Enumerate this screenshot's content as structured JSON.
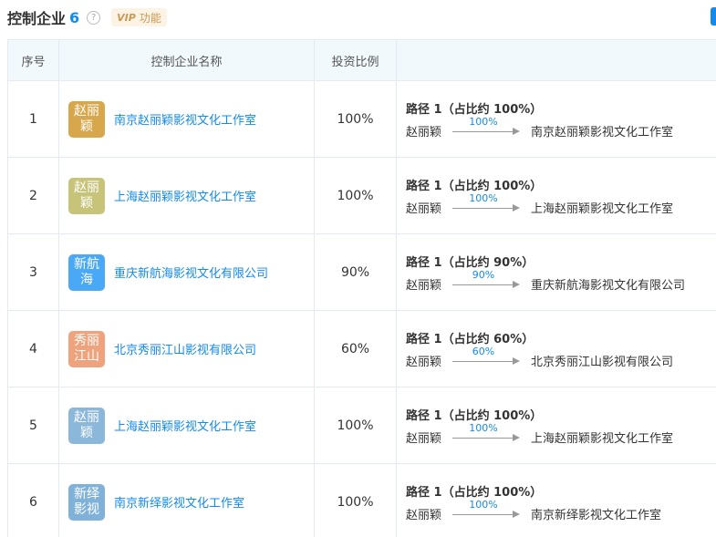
{
  "header": {
    "title": "控制企业",
    "count": "6",
    "help_glyph": "?",
    "vip_badge": "VIP",
    "vip_label": "功能"
  },
  "table": {
    "columns": [
      "序号",
      "控制企业名称",
      "投资比例",
      ""
    ],
    "rows": [
      {
        "index": "1",
        "logo_text": "赵丽颖",
        "logo_color": "#d8a74c",
        "name": "南京赵丽颖影视文化工作室",
        "ratio": "100%",
        "path_title": "路径 1（占比约 100%）",
        "from": "赵丽颖",
        "arrow_pct": "100%",
        "to": "南京赵丽颖影视文化工作室"
      },
      {
        "index": "2",
        "logo_text": "赵丽颖",
        "logo_color": "#c7c47a",
        "name": "上海赵丽颖影视文化工作室",
        "ratio": "100%",
        "path_title": "路径 1（占比约 100%）",
        "from": "赵丽颖",
        "arrow_pct": "100%",
        "to": "上海赵丽颖影视文化工作室"
      },
      {
        "index": "3",
        "logo_text": "新航海",
        "logo_color": "#4aa9f7",
        "name": "重庆新航海影视文化有限公司",
        "ratio": "90%",
        "path_title": "路径 1（占比约 90%）",
        "from": "赵丽颖",
        "arrow_pct": "90%",
        "to": "重庆新航海影视文化有限公司"
      },
      {
        "index": "4",
        "logo_text": "秀丽江山",
        "logo_color": "#eea37d",
        "name": "北京秀丽江山影视有限公司",
        "ratio": "60%",
        "path_title": "路径 1（占比约 60%）",
        "from": "赵丽颖",
        "arrow_pct": "60%",
        "to": "北京秀丽江山影视有限公司"
      },
      {
        "index": "5",
        "logo_text": "赵丽颖",
        "logo_color": "#8bb7da",
        "name": "上海赵丽颖影视文化工作室",
        "ratio": "100%",
        "path_title": "路径 1（占比约 100%）",
        "from": "赵丽颖",
        "arrow_pct": "100%",
        "to": "上海赵丽颖影视文化工作室"
      },
      {
        "index": "6",
        "logo_text": "新绎影视",
        "logo_color": "#7fb1d9",
        "name": "南京新绎影视文化工作室",
        "ratio": "100%",
        "path_title": "路径 1（占比约 100%）",
        "from": "赵丽颖",
        "arrow_pct": "100%",
        "to": "南京新绎影视文化工作室"
      }
    ]
  }
}
